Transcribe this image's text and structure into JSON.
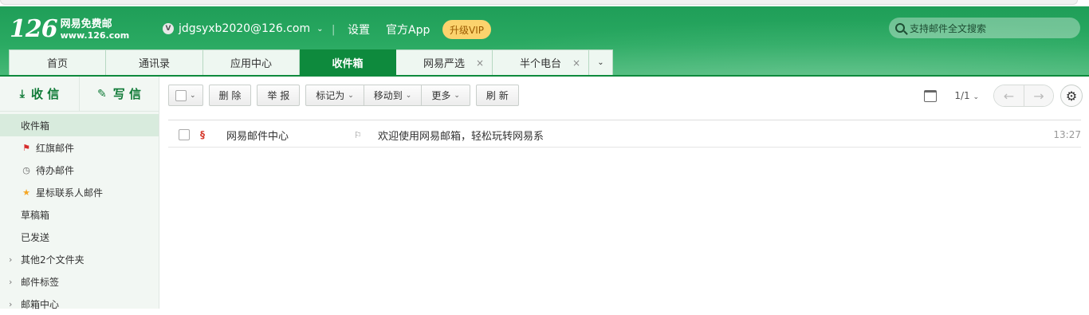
{
  "header": {
    "logo_number": "126",
    "logo_title": "网易免费邮",
    "logo_domain": "www.126.com",
    "user_badge": "V",
    "user_email": "jdgsyxb2020@126.com",
    "separator": "|",
    "links": [
      "设置",
      "官方App"
    ],
    "vip_label": "升级VIP",
    "search_placeholder": "支持邮件全文搜索"
  },
  "tabs": [
    {
      "label": "首页",
      "active": false,
      "closable": false
    },
    {
      "label": "通讯录",
      "active": false,
      "closable": false
    },
    {
      "label": "应用中心",
      "active": false,
      "closable": false
    },
    {
      "label": "收件箱",
      "active": true,
      "closable": false
    },
    {
      "label": "网易严选",
      "active": false,
      "closable": true
    },
    {
      "label": "半个电台",
      "active": false,
      "closable": true
    }
  ],
  "sidebar": {
    "receive_label": "收 信",
    "write_label": "写 信",
    "folders": [
      {
        "label": "收件箱",
        "icon": "",
        "active": true
      },
      {
        "label": "红旗邮件",
        "icon": "red-flag-icon",
        "active": false
      },
      {
        "label": "待办邮件",
        "icon": "clock-icon",
        "active": false
      },
      {
        "label": "星标联系人邮件",
        "icon": "star-icon",
        "active": false
      },
      {
        "label": "草稿箱",
        "icon": "",
        "active": false
      },
      {
        "label": "已发送",
        "icon": "",
        "active": false
      },
      {
        "label": "其他2个文件夹",
        "icon": "",
        "expandable": true
      },
      {
        "label": "邮件标签",
        "icon": "",
        "expandable": true
      },
      {
        "label": "邮箱中心",
        "icon": "",
        "expandable": true
      }
    ]
  },
  "toolbar": {
    "delete_label": "删 除",
    "report_label": "举 报",
    "mark_as_label": "标记为",
    "move_to_label": "移动到",
    "more_label": "更多",
    "refresh_label": "刷 新",
    "page_info": "1/1"
  },
  "mails": [
    {
      "sender": "网易邮件中心",
      "subject": "欢迎使用网易邮箱，轻松玩转网易系",
      "time": "13:27"
    }
  ],
  "colors": {
    "brand_green": "#0e8a3d",
    "vip_yellow": "#fcd36d",
    "sidebar_bg": "#f2f7f3"
  }
}
